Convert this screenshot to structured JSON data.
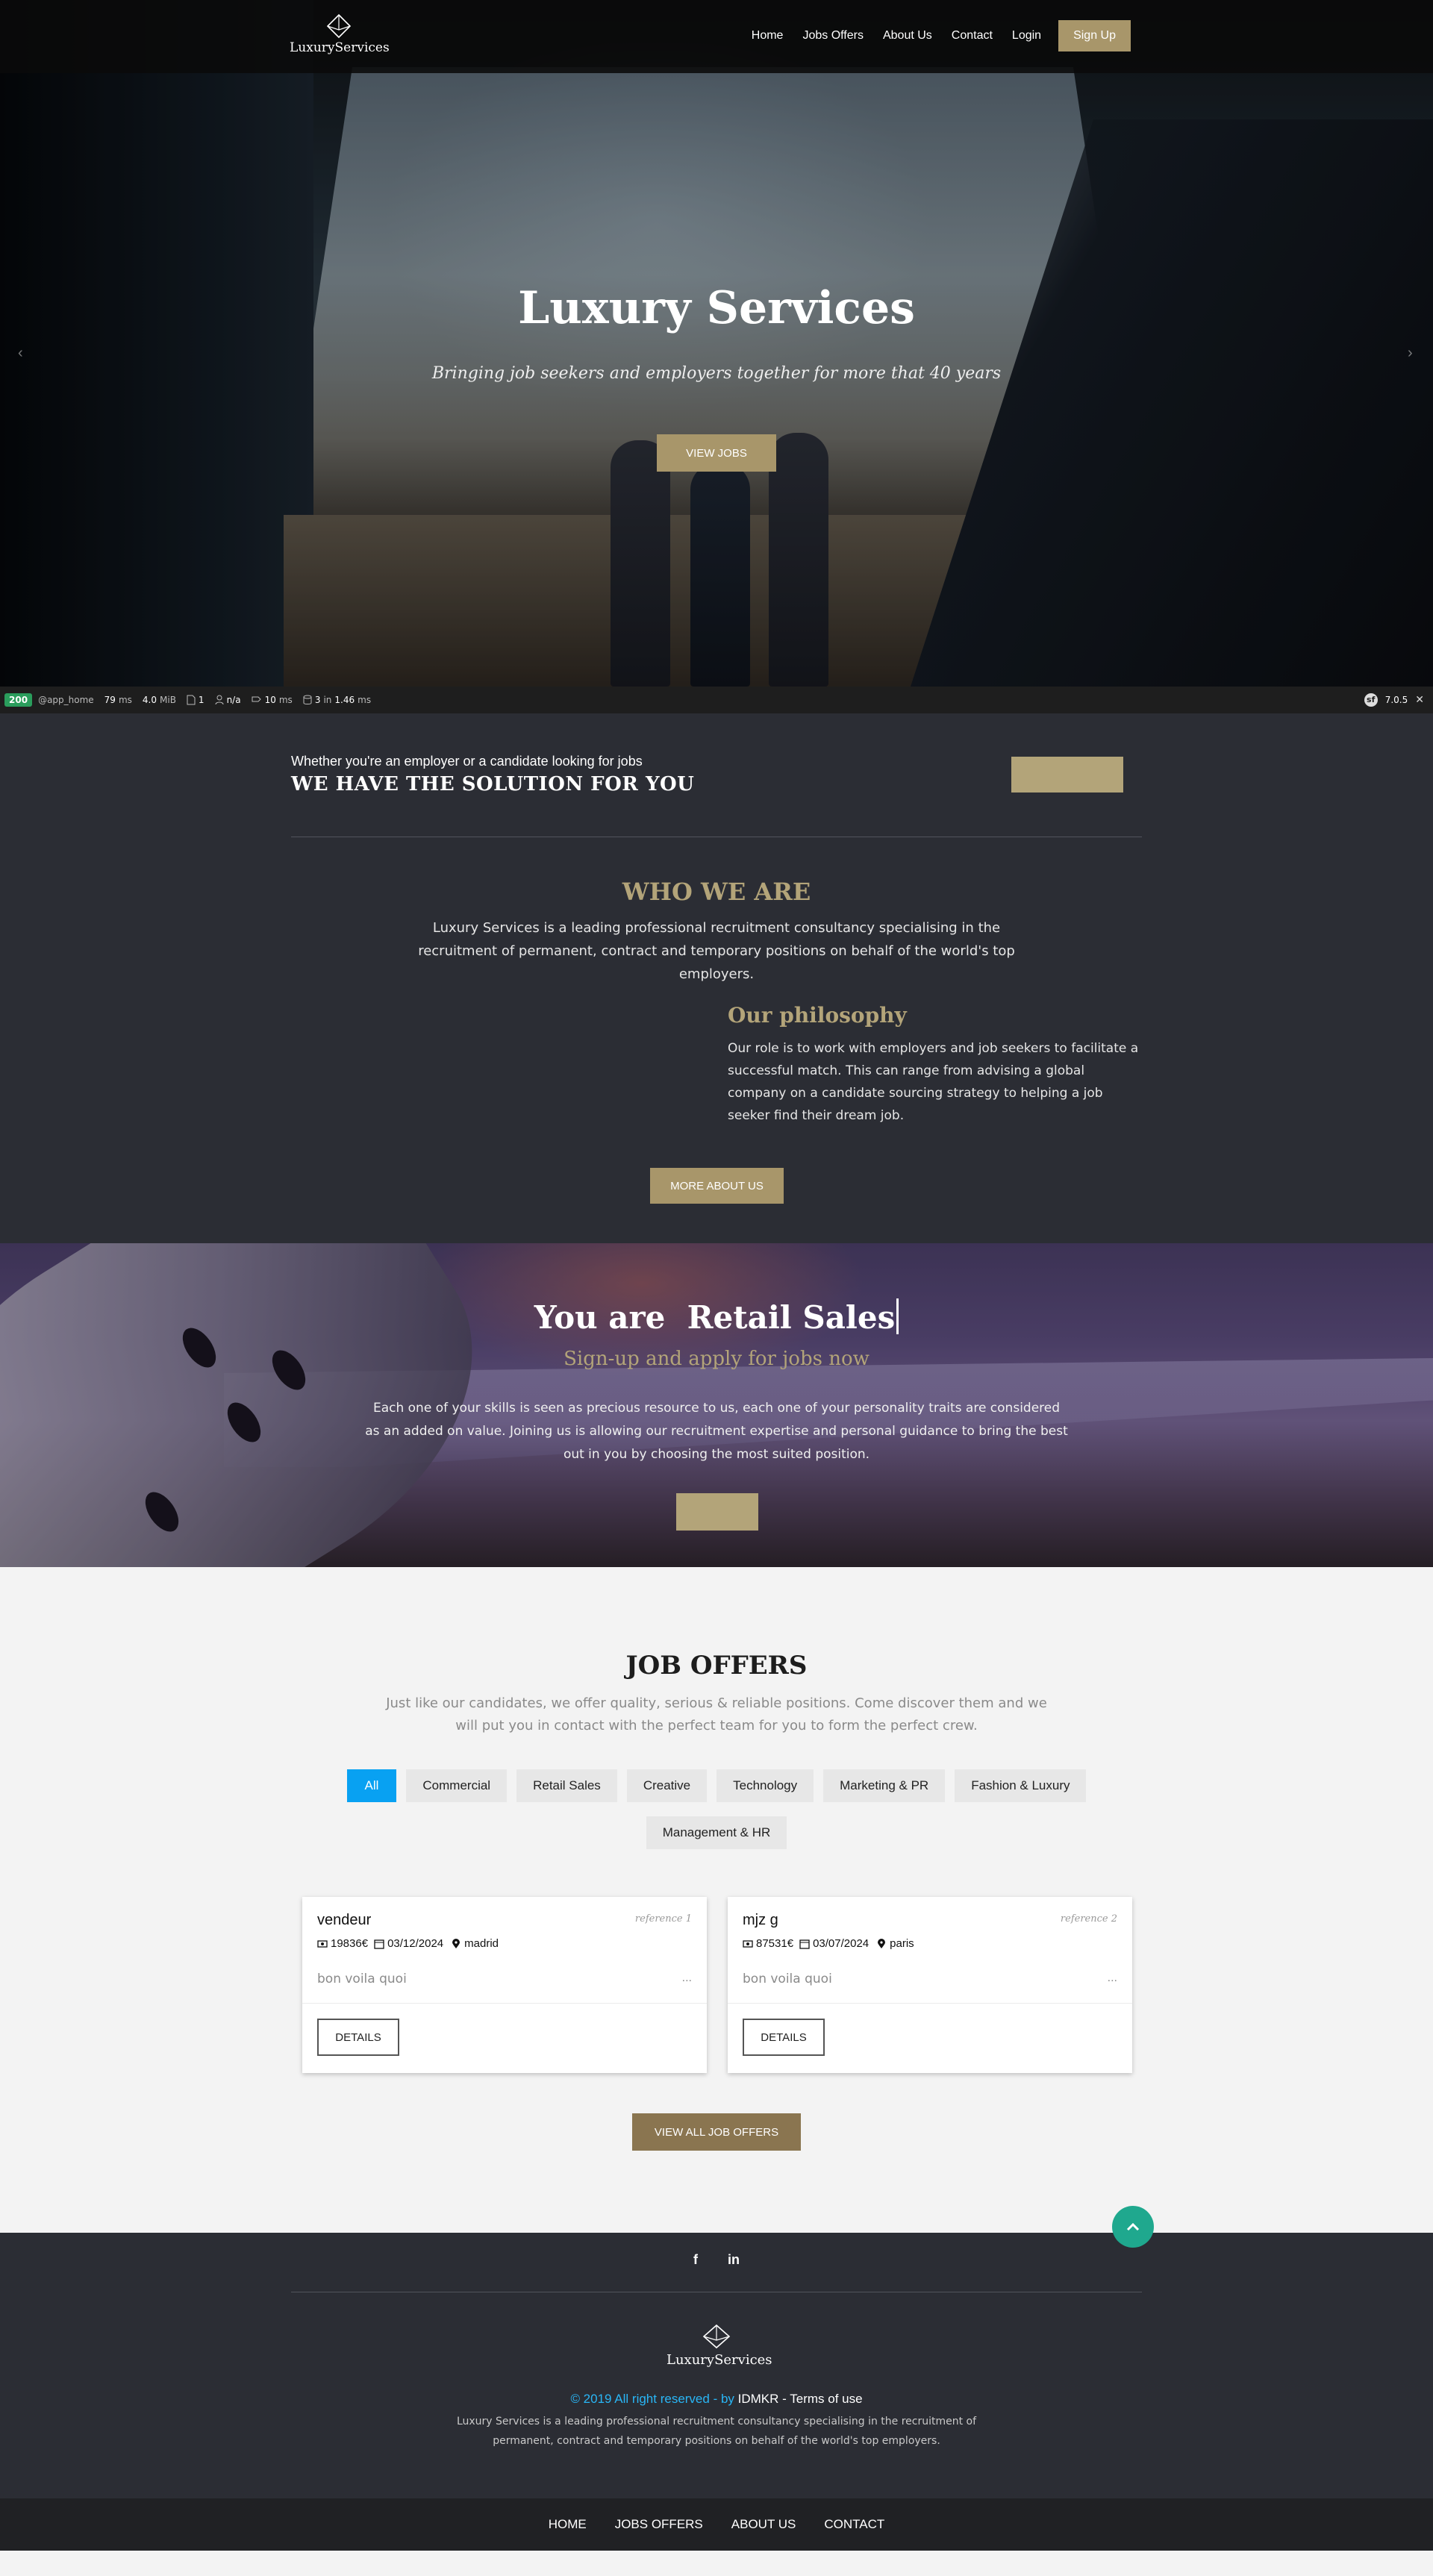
{
  "brand": {
    "name": "LuxuryServices"
  },
  "nav": {
    "items": [
      {
        "label": "Home"
      },
      {
        "label": "Jobs Offers"
      },
      {
        "label": "About Us"
      },
      {
        "label": "Contact"
      },
      {
        "label": "Login"
      }
    ],
    "signup_label": "Sign Up"
  },
  "hero": {
    "title": "Luxury Services",
    "subtitle": "Bringing job seekers and employers together for more that 40 years",
    "button_label": "VIEW JOBS"
  },
  "debug_toolbar": {
    "status_code": "200",
    "route": "@app_home",
    "time_value": "79",
    "time_unit": "ms",
    "memory": "4.0",
    "memory_unit": "MiB",
    "logs": "1",
    "user": "n/a",
    "events_value": "10",
    "events_unit": "ms",
    "db_queries": "3",
    "db_in": "in",
    "db_time": "1.46",
    "db_unit": "ms",
    "version": "7.0.5",
    "close": "✕"
  },
  "solution": {
    "small": "Whether you're an employer or a candidate looking for jobs",
    "big": "WE HAVE THE SOLUTION FOR YOU"
  },
  "who": {
    "title": "WHO WE ARE",
    "text": "Luxury Services is a leading professional recruitment consultancy specialising in the recruitment of permanent, contract and temporary positions on behalf of the world's top employers."
  },
  "philosophy": {
    "title": "Our philosophy",
    "text": "Our role is to work with employers and job seekers to facilitate a successful match. This can range from advising a global company on a candidate sourcing strategy to helping a job seeker find their dream job.",
    "button_label": "MORE ABOUT US"
  },
  "cta": {
    "you_are": "You are",
    "role": "Retail Sales",
    "signup_line": "Sign-up and apply for jobs now",
    "text": "Each one of your skills is seen as precious resource to us, each one of your personality traits are considered as an added on value. Joining us is allowing our recruitment expertise and personal guidance to bring the best out in you by choosing the most suited position."
  },
  "jobs": {
    "title": "JOB OFFERS",
    "subtitle": "Just like our candidates, we offer quality, serious & reliable positions. Come discover them and we will put you in contact with the perfect team for you to form the perfect crew.",
    "filters": [
      {
        "label": "All"
      },
      {
        "label": "Commercial"
      },
      {
        "label": "Retail Sales"
      },
      {
        "label": "Creative"
      },
      {
        "label": "Technology"
      },
      {
        "label": "Marketing & PR"
      },
      {
        "label": "Fashion & Luxury"
      },
      {
        "label": "Management & HR"
      }
    ],
    "cards": [
      {
        "title": "vendeur",
        "reference": "reference 1",
        "salary": "19836€",
        "date": "03/12/2024",
        "location": "madrid",
        "description": "bon voila quoi",
        "more": "...",
        "button_label": "DETAILS"
      },
      {
        "title": "mjz g",
        "reference": "reference 2",
        "salary": "87531€",
        "date": "03/07/2024",
        "location": "paris",
        "description": "bon voila quoi",
        "more": "...",
        "button_label": "DETAILS"
      }
    ],
    "view_all_label": "VIEW ALL JOB OFFERS"
  },
  "footer": {
    "social": [
      {
        "label": "f",
        "icon": "facebook-icon"
      },
      {
        "label": "in",
        "icon": "linkedin-icon"
      }
    ],
    "brand": "LuxuryServices",
    "copyright_prefix": "© 2019 All right reserved - by",
    "copyright_author": "IDMKR",
    "copyright_sep": "-",
    "terms": "Terms of use",
    "text": "Luxury Services is a leading professional recruitment consultancy specialising in the recruitment of permanent, contract and temporary positions on behalf of the world's top employers.",
    "bottom_nav": [
      {
        "label": "HOME"
      },
      {
        "label": "JOBS OFFERS"
      },
      {
        "label": "ABOUT US"
      },
      {
        "label": "CONTACT"
      }
    ]
  },
  "colors": {
    "gold": "#a8966a",
    "dark": "#2b2d34",
    "active_filter": "#08a1f2",
    "scroll_top": "#1fa88e"
  },
  "carousel": {
    "prev": "‹",
    "next": "›"
  }
}
